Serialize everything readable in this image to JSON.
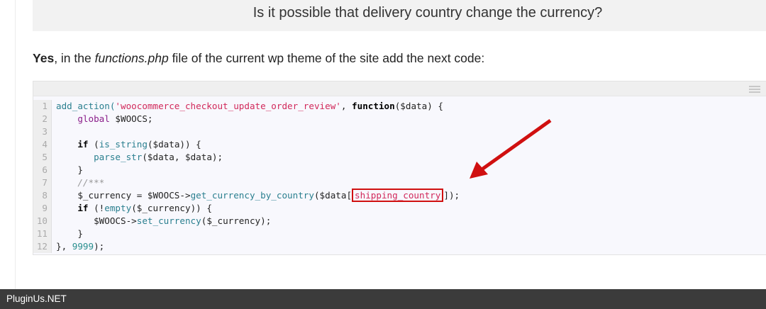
{
  "question": "Is it possible that delivery country change the currency?",
  "intro": {
    "bold": "Yes",
    "p1": ", in the ",
    "italic": "functions.php",
    "p2": " file of the current wp theme of the site add the next code:"
  },
  "code": {
    "line_numbers": [
      "1",
      "2",
      "3",
      "4",
      "5",
      "6",
      "7",
      "8",
      "9",
      "10",
      "11",
      "12"
    ],
    "l1a": "add_action(",
    "l1b": "'woocommerce_checkout_update_order_review'",
    "l1c": ", ",
    "l1d": "function",
    "l1e": "($data) {",
    "l2a": "    ",
    "l2b": "global",
    "l2c": " $WOOCS;",
    "l4a": "    ",
    "l4b": "if",
    "l4c": " (",
    "l4d": "is_string",
    "l4e": "($data)) {",
    "l5a": "       ",
    "l5b": "parse_str",
    "l5c": "($data, $data);",
    "l6": "    }",
    "l7a": "    ",
    "l7b": "//***",
    "l8a": "    $_currency = $WOOCS->",
    "l8b": "get_currency_by_country",
    "l8c": "($data[",
    "l8d": "shipping_country",
    "l8e": "]);",
    "l9a": "    ",
    "l9b": "if",
    "l9c": " (!",
    "l9d": "empty",
    "l9e": "($_currency)) {",
    "l10a": "       $WOOCS->",
    "l10b": "set_currency",
    "l10c": "($_currency);",
    "l11": "    }",
    "l12a": "}, ",
    "l12b": "9999",
    "l12c": ");"
  },
  "footer": "PluginUs.NET",
  "colors": {
    "arrow": "#d01010",
    "highlight": "#d01010"
  }
}
